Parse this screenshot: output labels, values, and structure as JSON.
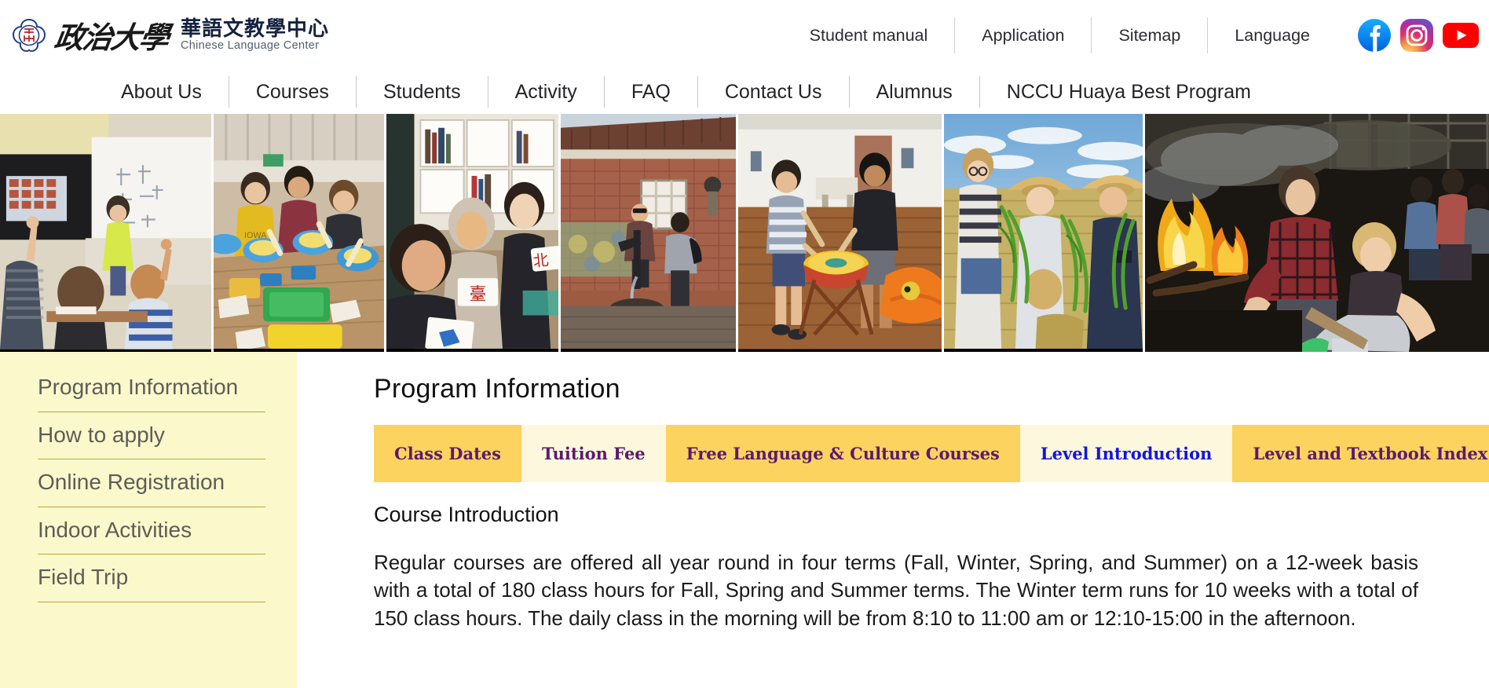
{
  "site": {
    "logo_cn": "華語文教學中心",
    "logo_en": "Chinese Language Center",
    "logo_calligraphy": "政治大學",
    "seal_icon": "nccu-plum-blossom-seal-icon"
  },
  "topnav": {
    "items": [
      {
        "label": "Student manual"
      },
      {
        "label": "Application"
      },
      {
        "label": "Sitemap"
      },
      {
        "label": "Language"
      }
    ],
    "socials": [
      {
        "name": "facebook-icon",
        "color": "#1877F2"
      },
      {
        "name": "instagram-icon",
        "color": "#E1306C"
      },
      {
        "name": "youtube-icon",
        "color": "#FF0000"
      }
    ]
  },
  "mainnav": {
    "items": [
      {
        "label": "About Us"
      },
      {
        "label": "Courses"
      },
      {
        "label": "Students"
      },
      {
        "label": "Activity"
      },
      {
        "label": "FAQ"
      },
      {
        "label": "Contact Us"
      },
      {
        "label": "Alumnus"
      },
      {
        "label": "NCCU Huaya Best Program"
      }
    ]
  },
  "banner": {
    "photos": [
      {
        "alt": "classroom-lesson-with-teacher-at-whiteboard"
      },
      {
        "alt": "students-cooking-activity-with-blue-bowls"
      },
      {
        "alt": "three-students-holding-taipei-calligraphy-cards"
      },
      {
        "alt": "students-at-historic-red-brick-house-water-pump"
      },
      {
        "alt": "students-playing-traditional-drum"
      },
      {
        "alt": "students-rice-harvest-with-straw-hats"
      },
      {
        "alt": "students-at-outdoor-campfire"
      }
    ]
  },
  "sidebar": {
    "items": [
      {
        "label": "Program Information"
      },
      {
        "label": "How to apply"
      },
      {
        "label": "Online Registration"
      },
      {
        "label": "Indoor Activities"
      },
      {
        "label": "Field Trip"
      }
    ]
  },
  "main": {
    "title": "Program Information",
    "tabs": [
      {
        "label": "Class Dates",
        "state": "on",
        "color": "#5c1a6e"
      },
      {
        "label": "Tuition Fee",
        "state": "off",
        "color": "#5c1a6e"
      },
      {
        "label": "Free Language & Culture Courses",
        "state": "on",
        "color": "#5c1a6e"
      },
      {
        "label": "Level Introduction",
        "state": "off",
        "color": "#1414e0"
      },
      {
        "label": "Level and Textbook Index",
        "state": "on",
        "color": "#5c1a6e"
      }
    ],
    "section_title": "Course Introduction",
    "paragraph": "Regular courses are offered all year round in four terms (Fall, Winter, Spring, and Summer) on a 12-week basis with a total of 180 class hours for Fall, Spring and Summer terms. The Winter term runs for 10 weeks with a total of 150 class hours. The daily class in the morning will be from 8:10 to 11:00 am or 12:10-15:00 in the afternoon."
  },
  "colors": {
    "sidebar_bg": "#fbf9cc",
    "tab_active_bg": "#fcd35f",
    "tab_inactive_bg": "#fdf8dd",
    "tab_text": "#5c1a6e",
    "tab_text_alt": "#1414e0",
    "sidebar_rule": "#b8a53a"
  }
}
